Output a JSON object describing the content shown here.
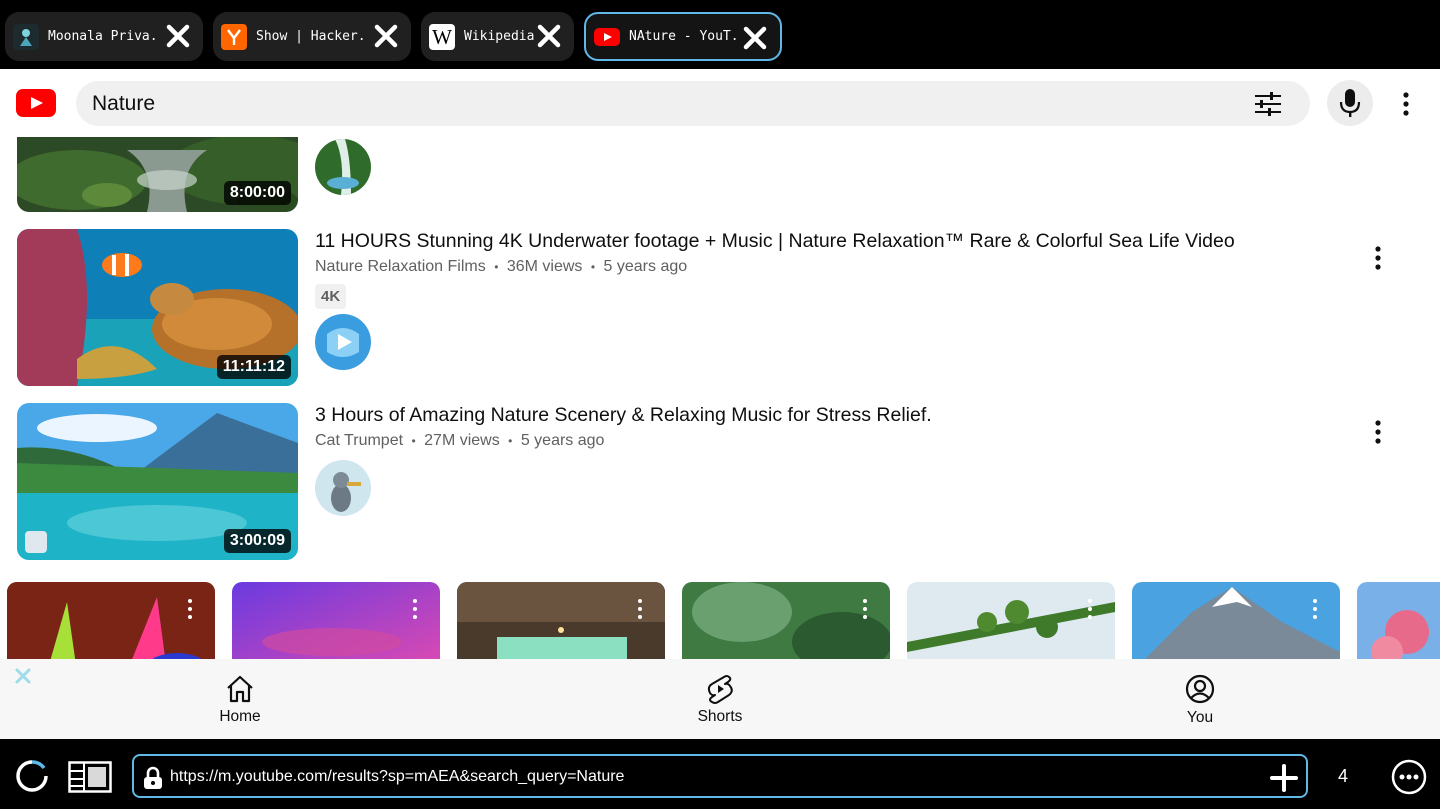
{
  "browser": {
    "tabs": [
      {
        "label": "Moonala Priva..",
        "active": false
      },
      {
        "label": "Show | Hacker..",
        "active": false
      },
      {
        "label": "Wikipedia",
        "active": false
      },
      {
        "label": "NAture - YouT..",
        "active": true
      }
    ],
    "address_url": "https://m.youtube.com/results?sp=mAEA&search_query=Nature",
    "tab_count": "4",
    "accent_color": "#5fb8e6"
  },
  "header": {
    "search_query": "Nature",
    "brand_color": "#ff0000"
  },
  "results": [
    {
      "title": "",
      "channel": "",
      "duration": "8:00:00"
    },
    {
      "title": "11 HOURS Stunning 4K Underwater footage + Music | Nature Relaxation™ Rare & Colorful Sea Life Video",
      "channel": "Nature Relaxation Films",
      "views": "36M views",
      "age": "5 years ago",
      "badge": "4K",
      "duration": "11:11:12"
    },
    {
      "title": "3 Hours of Amazing Nature Scenery & Relaxing Music for Stress Relief.",
      "channel": "Cat Trumpet",
      "views": "27M views",
      "age": "5 years ago",
      "duration": "3:00:09"
    }
  ],
  "meta_separator": "•",
  "bottom_nav": {
    "home": "Home",
    "shorts": "Shorts",
    "you": "You"
  }
}
